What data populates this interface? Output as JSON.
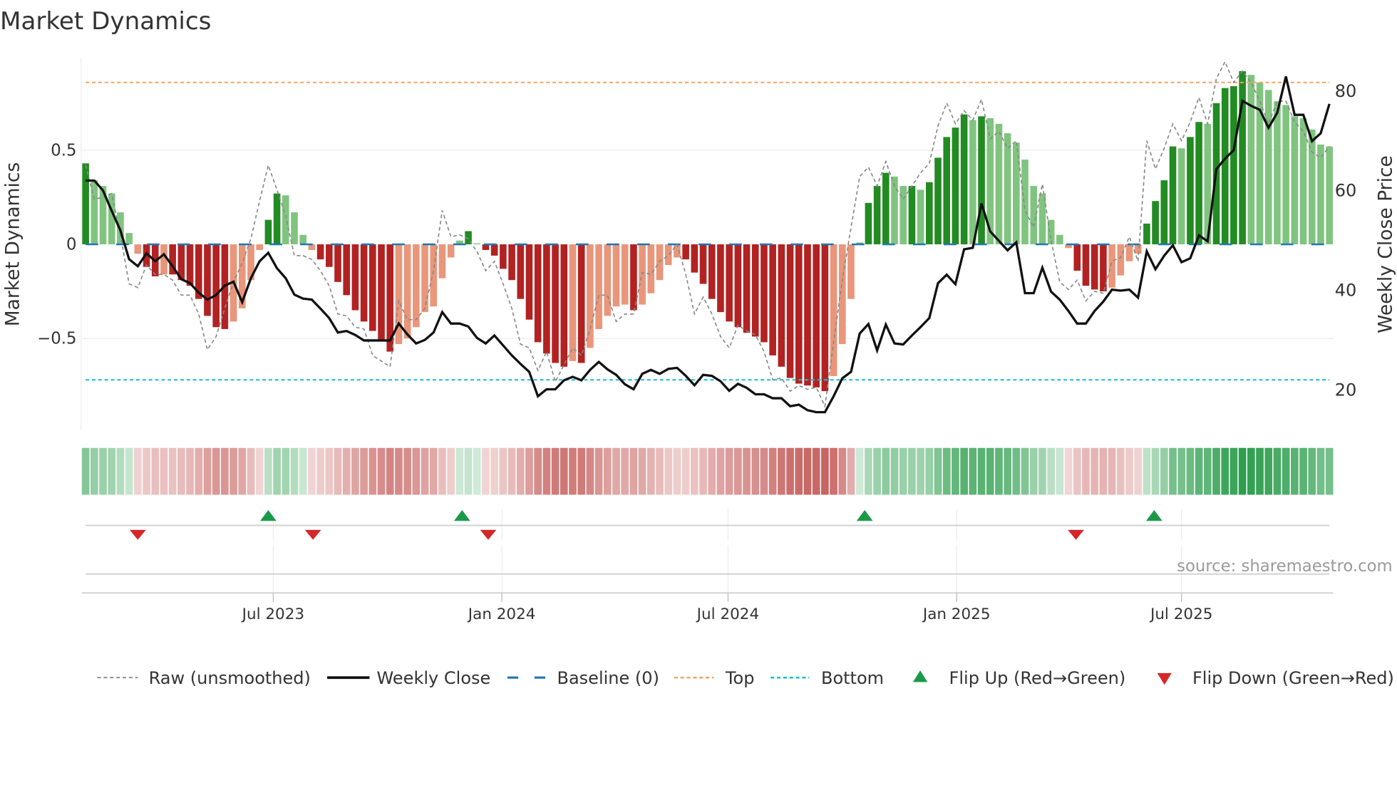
{
  "chart_data": {
    "type": "bar",
    "title": "Market Dynamics",
    "ylabel": "Market Dynamics",
    "y2label": "Weekly Close Price",
    "ylim": [
      -0.92,
      1.0
    ],
    "y2lim": [
      15,
      85
    ],
    "yticks": [
      {
        "value": 0.5,
        "label": "0.5"
      },
      {
        "value": 0,
        "label": "0"
      },
      {
        "value": -0.5,
        "label": "−0.5"
      }
    ],
    "y2ticks": [
      {
        "value": 80,
        "label": "80"
      },
      {
        "value": 60,
        "label": "60"
      },
      {
        "value": 40,
        "label": "40"
      },
      {
        "value": 20,
        "label": "20"
      }
    ],
    "xticks": [
      {
        "date": "2023-07-01",
        "label": "Jul 2023"
      },
      {
        "date": "2024-01-01",
        "label": "Jan 2024"
      },
      {
        "date": "2024-07-01",
        "label": "Jul 2024"
      },
      {
        "date": "2025-01-01",
        "label": "Jan 2025"
      },
      {
        "date": "2025-07-01",
        "label": "Jul 2025"
      }
    ],
    "start_date": "2023-01-31",
    "frequency": "weekly",
    "grid": true,
    "legend_position": "bottom",
    "top_level": 0.86,
    "bottom_level": -0.72,
    "baseline": 0,
    "colors": {
      "up_strong": "#228b22",
      "up_weak": "#80c480",
      "down_strong": "#b22222",
      "down_weak": "#e9967a",
      "price": "#111111",
      "raw": "#888888",
      "baseline": "#1f77b4",
      "top": "#f4a460",
      "bottom": "#17becf",
      "flip_up": "#1a9a48",
      "flip_down": "#d62728",
      "heat_green": "#2e9e4f",
      "heat_red": "#c0504d"
    },
    "series": [
      {
        "name": "Market Dynamics",
        "values": [
          0.43,
          0.34,
          0.31,
          0.27,
          0.17,
          0.06,
          -0.05,
          -0.12,
          -0.17,
          -0.16,
          -0.16,
          -0.19,
          -0.22,
          -0.29,
          -0.38,
          -0.44,
          -0.45,
          -0.41,
          -0.34,
          -0.19,
          -0.03,
          0.13,
          0.27,
          0.26,
          0.17,
          0.05,
          -0.03,
          -0.08,
          -0.12,
          -0.2,
          -0.27,
          -0.35,
          -0.41,
          -0.46,
          -0.51,
          -0.57,
          -0.53,
          -0.5,
          -0.44,
          -0.36,
          -0.33,
          -0.18,
          -0.07,
          0.02,
          0.07,
          0.005,
          -0.03,
          -0.06,
          -0.13,
          -0.19,
          -0.29,
          -0.4,
          -0.52,
          -0.58,
          -0.63,
          -0.65,
          -0.62,
          -0.63,
          -0.55,
          -0.45,
          -0.38,
          -0.33,
          -0.32,
          -0.35,
          -0.32,
          -0.26,
          -0.19,
          -0.11,
          -0.07,
          -0.08,
          -0.15,
          -0.21,
          -0.29,
          -0.36,
          -0.41,
          -0.44,
          -0.47,
          -0.49,
          -0.52,
          -0.59,
          -0.65,
          -0.71,
          -0.74,
          -0.75,
          -0.76,
          -0.78,
          -0.7,
          -0.53,
          -0.29,
          0.01,
          0.22,
          0.31,
          0.38,
          0.36,
          0.31,
          0.31,
          0.29,
          0.33,
          0.46,
          0.57,
          0.62,
          0.69,
          0.66,
          0.68,
          0.67,
          0.64,
          0.59,
          0.54,
          0.45,
          0.31,
          0.27,
          0.13,
          0.05,
          -0.02,
          -0.14,
          -0.22,
          -0.24,
          -0.25,
          -0.23,
          -0.165,
          -0.09,
          -0.05,
          0.11,
          0.23,
          0.34,
          0.52,
          0.51,
          0.57,
          0.65,
          0.64,
          0.75,
          0.83,
          0.84,
          0.92,
          0.9,
          0.86,
          0.82,
          0.76,
          0.74,
          0.68,
          0.67,
          0.61,
          0.53,
          0.52
        ]
      },
      {
        "name": "Raw (unsmoothed)",
        "values": [
          0.42,
          0.24,
          0.25,
          0.27,
          0.05,
          -0.21,
          -0.23,
          -0.11,
          -0.16,
          -0.16,
          -0.19,
          -0.27,
          -0.27,
          -0.37,
          -0.56,
          -0.49,
          -0.34,
          -0.2,
          -0.1,
          0.03,
          0.23,
          0.42,
          0.29,
          0.15,
          -0.06,
          -0.06,
          -0.08,
          -0.14,
          -0.22,
          -0.37,
          -0.38,
          -0.44,
          -0.45,
          -0.59,
          -0.62,
          -0.65,
          -0.3,
          -0.4,
          -0.4,
          -0.34,
          -0.14,
          0.18,
          0.04,
          0.05,
          0.03,
          -0.04,
          -0.14,
          -0.09,
          -0.21,
          -0.34,
          -0.53,
          -0.55,
          -0.67,
          -0.57,
          -0.73,
          -0.64,
          -0.55,
          -0.59,
          -0.45,
          -0.27,
          -0.27,
          -0.41,
          -0.37,
          -0.37,
          -0.15,
          -0.16,
          -0.09,
          -0.06,
          0.0,
          -0.16,
          -0.37,
          -0.28,
          -0.37,
          -0.49,
          -0.55,
          -0.43,
          -0.46,
          -0.48,
          -0.57,
          -0.72,
          -0.71,
          -0.78,
          -0.75,
          -0.77,
          -0.76,
          -0.86,
          -0.52,
          -0.19,
          0.09,
          0.36,
          0.41,
          0.31,
          0.44,
          0.31,
          0.24,
          0.31,
          0.38,
          0.43,
          0.63,
          0.75,
          0.64,
          0.71,
          0.66,
          0.77,
          0.56,
          0.6,
          0.51,
          0.55,
          0.18,
          0.09,
          0.32,
          0.02,
          -0.2,
          -0.24,
          -0.19,
          -0.3,
          -0.25,
          -0.26,
          -0.09,
          -0.07,
          0.04,
          -0.09,
          0.55,
          0.4,
          0.51,
          0.64,
          0.55,
          0.65,
          0.78,
          0.64,
          0.88,
          0.97,
          0.86,
          0.92,
          0.86,
          0.76,
          0.64,
          0.76,
          0.76,
          0.65,
          0.6,
          0.49,
          0.46,
          0.52
        ]
      },
      {
        "name": "Weekly Close",
        "axis": "right",
        "values": [
          61.9,
          61.9,
          59.9,
          55.8,
          51.9,
          46.1,
          44.7,
          47.3,
          45.7,
          47.1,
          44.7,
          42.1,
          41.3,
          39.4,
          38.0,
          38.9,
          40.8,
          41.6,
          37.5,
          42.3,
          45.7,
          47.4,
          44.3,
          42.3,
          39.0,
          38.2,
          38.0,
          36.2,
          34.3,
          31.4,
          31.7,
          30.9,
          29.8,
          29.8,
          29.8,
          29.8,
          33.2,
          31.0,
          29.2,
          29.9,
          31.4,
          35.5,
          33.2,
          33.2,
          32.6,
          30.3,
          29.2,
          30.8,
          28.8,
          26.8,
          25.1,
          23.5,
          18.6,
          20.0,
          20.0,
          21.8,
          22.5,
          21.8,
          23.9,
          25.5,
          24.0,
          22.9,
          21.0,
          20.0,
          23.1,
          23.9,
          23.1,
          24.1,
          24.3,
          22.7,
          20.8,
          22.9,
          22.7,
          21.6,
          19.7,
          21.1,
          20.3,
          19.0,
          19.0,
          18.2,
          18.2,
          16.6,
          16.9,
          15.8,
          15.4,
          15.4,
          18.6,
          22.2,
          23.5,
          31.2,
          33.1,
          27.8,
          33.0,
          29.2,
          29.0,
          30.8,
          32.5,
          34.3,
          41.3,
          43.0,
          41.1,
          48.1,
          48.4,
          57.3,
          51.7,
          49.8,
          47.9,
          49.5,
          39.3,
          39.3,
          44.4,
          39.6,
          38.0,
          35.7,
          33.2,
          33.2,
          35.7,
          37.6,
          40.0,
          39.8,
          40.0,
          38.4,
          47.7,
          44.1,
          46.8,
          48.9,
          45.5,
          46.3,
          50.9,
          49.7,
          64.2,
          66.3,
          68.0,
          77.9,
          76.9,
          76.1,
          72.5,
          75.5,
          82.8,
          75.1,
          75.1,
          69.8,
          71.4,
          77.3
        ]
      }
    ],
    "flips": {
      "up": [
        "2023-06-27",
        "2023-11-30",
        "2024-10-19",
        "2025-06-09"
      ],
      "down": [
        "2023-03-14",
        "2023-08-02",
        "2023-12-21",
        "2025-04-07"
      ]
    },
    "annotation": "source: sharemaestro.com",
    "legend": [
      {
        "label": "Raw (unsmoothed)",
        "icon": "dashed-gray-line"
      },
      {
        "label": "Weekly Close",
        "icon": "solid-black-line"
      },
      {
        "label": "Baseline (0)",
        "icon": "dashed-blue-line"
      },
      {
        "label": "Top",
        "icon": "dotted-orange-line"
      },
      {
        "label": "Bottom",
        "icon": "dotted-cyan-line"
      },
      {
        "label": "Flip Up (Red→Green)",
        "icon": "green-up-triangle"
      },
      {
        "label": "Flip Down (Green→Red)",
        "icon": "red-down-triangle"
      }
    ]
  }
}
